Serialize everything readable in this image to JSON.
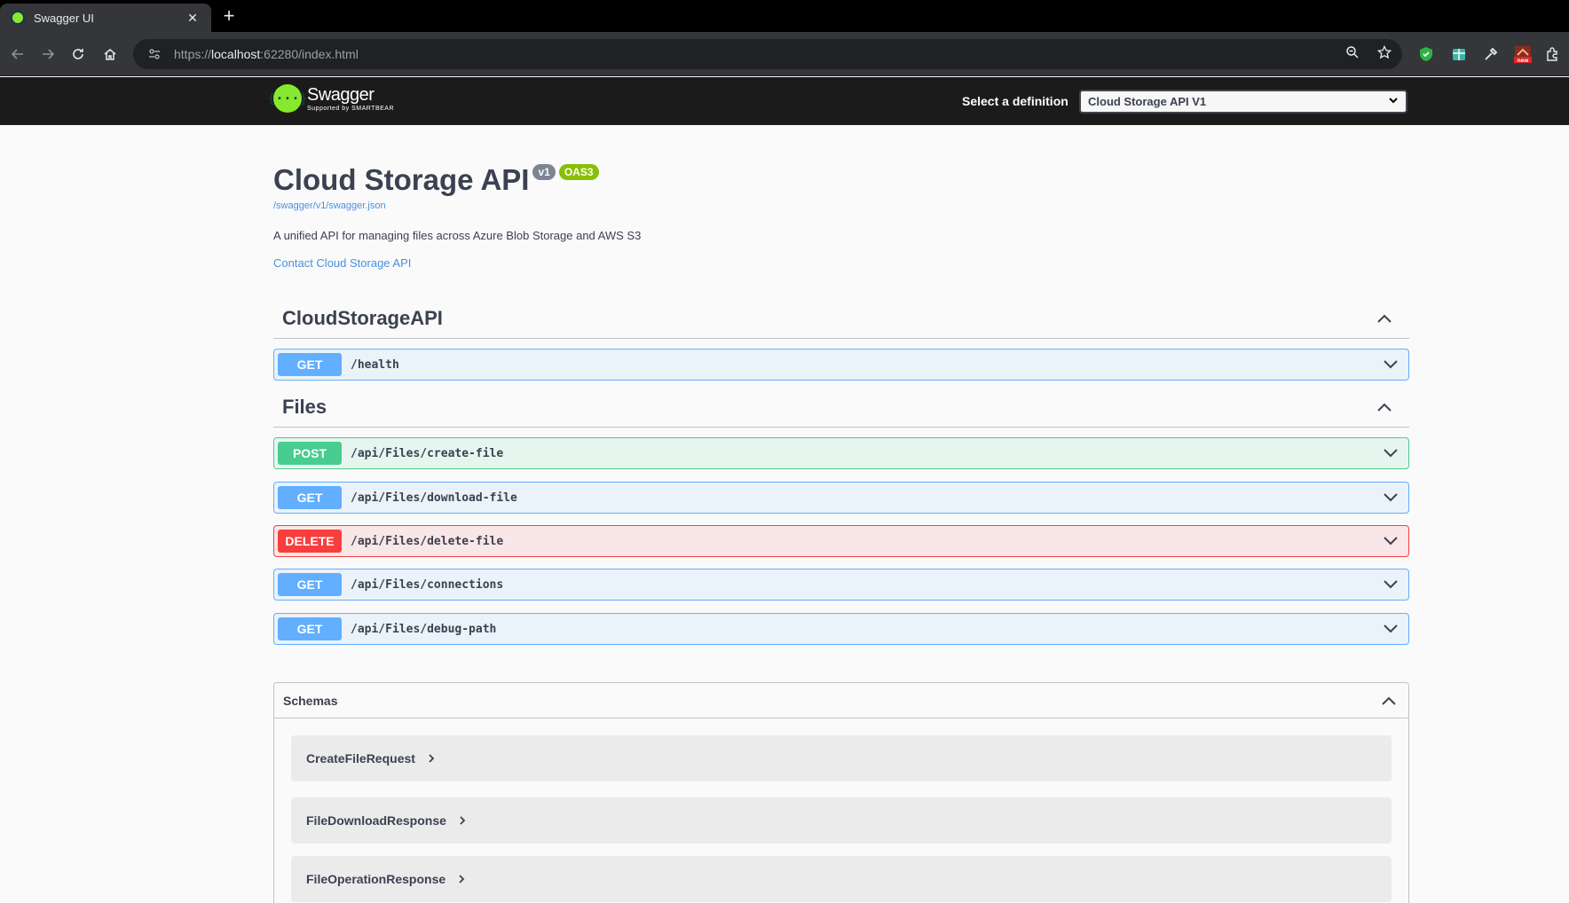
{
  "browser": {
    "tab_title": "Swagger UI",
    "tab_close": "✕",
    "new_tab": "+",
    "url_scheme": "https://",
    "url_host": "localhost",
    "url_rest": ":62280/index.html",
    "extension_badge": "new"
  },
  "topbar": {
    "logo_name": "Swagger",
    "logo_sub": "Supported by SMARTBEAR",
    "logo_glyph": "{···}",
    "definition_label": "Select a definition",
    "definition_value": "Cloud Storage API V1"
  },
  "info": {
    "title": "Cloud Storage API",
    "version_badge": "v1",
    "oas_badge": "OAS3",
    "spec_link": "/swagger/v1/swagger.json",
    "description": "A unified API for managing files across Azure Blob Storage and AWS S3",
    "contact": "Contact Cloud Storage API"
  },
  "tags": [
    {
      "name": "CloudStorageAPI",
      "operations": [
        {
          "method": "GET",
          "path": "/health"
        }
      ]
    },
    {
      "name": "Files",
      "operations": [
        {
          "method": "POST",
          "path": "/api/Files/create-file"
        },
        {
          "method": "GET",
          "path": "/api/Files/download-file"
        },
        {
          "method": "DELETE",
          "path": "/api/Files/delete-file"
        },
        {
          "method": "GET",
          "path": "/api/Files/connections"
        },
        {
          "method": "GET",
          "path": "/api/Files/debug-path"
        }
      ]
    }
  ],
  "schemas": {
    "title": "Schemas",
    "models": [
      "CreateFileRequest",
      "FileDownloadResponse",
      "FileOperationResponse"
    ]
  },
  "colors": {
    "get": "#61affe",
    "post": "#49cc90",
    "delete": "#f93e3e",
    "swagger_green": "#85ea2d",
    "link": "#4990e2"
  }
}
